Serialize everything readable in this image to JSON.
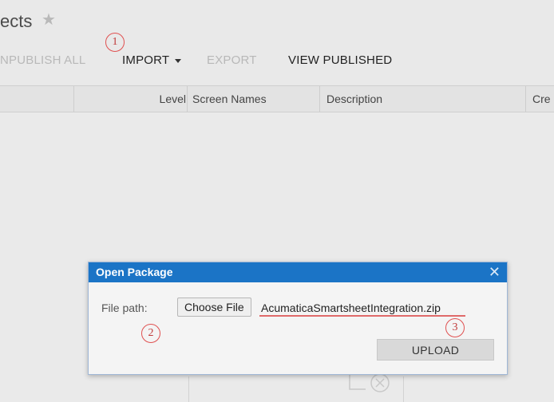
{
  "header": {
    "title": "ects",
    "star_icon": "star-icon"
  },
  "toolbar": {
    "unpublish_all": "NPUBLISH ALL",
    "import": "IMPORT",
    "export": "EXPORT",
    "view_published": "VIEW PUBLISHED"
  },
  "grid": {
    "columns": [
      "Level",
      "Screen Names",
      "Description",
      "Cre"
    ]
  },
  "annotations": [
    "1",
    "2",
    "3"
  ],
  "dialog": {
    "title": "Open Package",
    "file_path_label": "File path:",
    "choose_file_label": "Choose File",
    "file_name": "AcumaticaSmartsheetIntegration.zip",
    "upload_label": "UPLOAD"
  },
  "colors": {
    "dialog_titlebar": "#1b74c6",
    "annotation": "#e05050"
  }
}
